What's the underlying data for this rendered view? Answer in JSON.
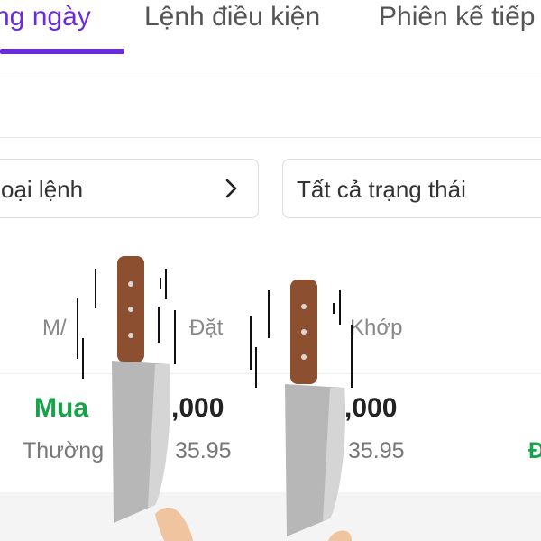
{
  "tabs": [
    {
      "label": "ng ngày",
      "active": true
    },
    {
      "label": "Lệnh điều kiện",
      "active": false
    },
    {
      "label": "Phiên kế tiếp",
      "active": false
    }
  ],
  "filters": {
    "order_type": "oại lệnh",
    "status": "Tất cả trạng thái"
  },
  "columns": {
    "side": "M/",
    "placed": "Đặt",
    "matched": "Khớp"
  },
  "row": {
    "side": "Mua",
    "order_type": "Thường",
    "placed_qty": ",000",
    "placed_price": "35.95",
    "matched_qty": ",000",
    "matched_price": "35.95",
    "edge_text": "Đ"
  },
  "overlay": {
    "icons": [
      "knife-icon",
      "knife-icon",
      "hand-icon"
    ]
  },
  "colors": {
    "accent": "#6a2bd9",
    "buy_green": "#16a34a"
  }
}
